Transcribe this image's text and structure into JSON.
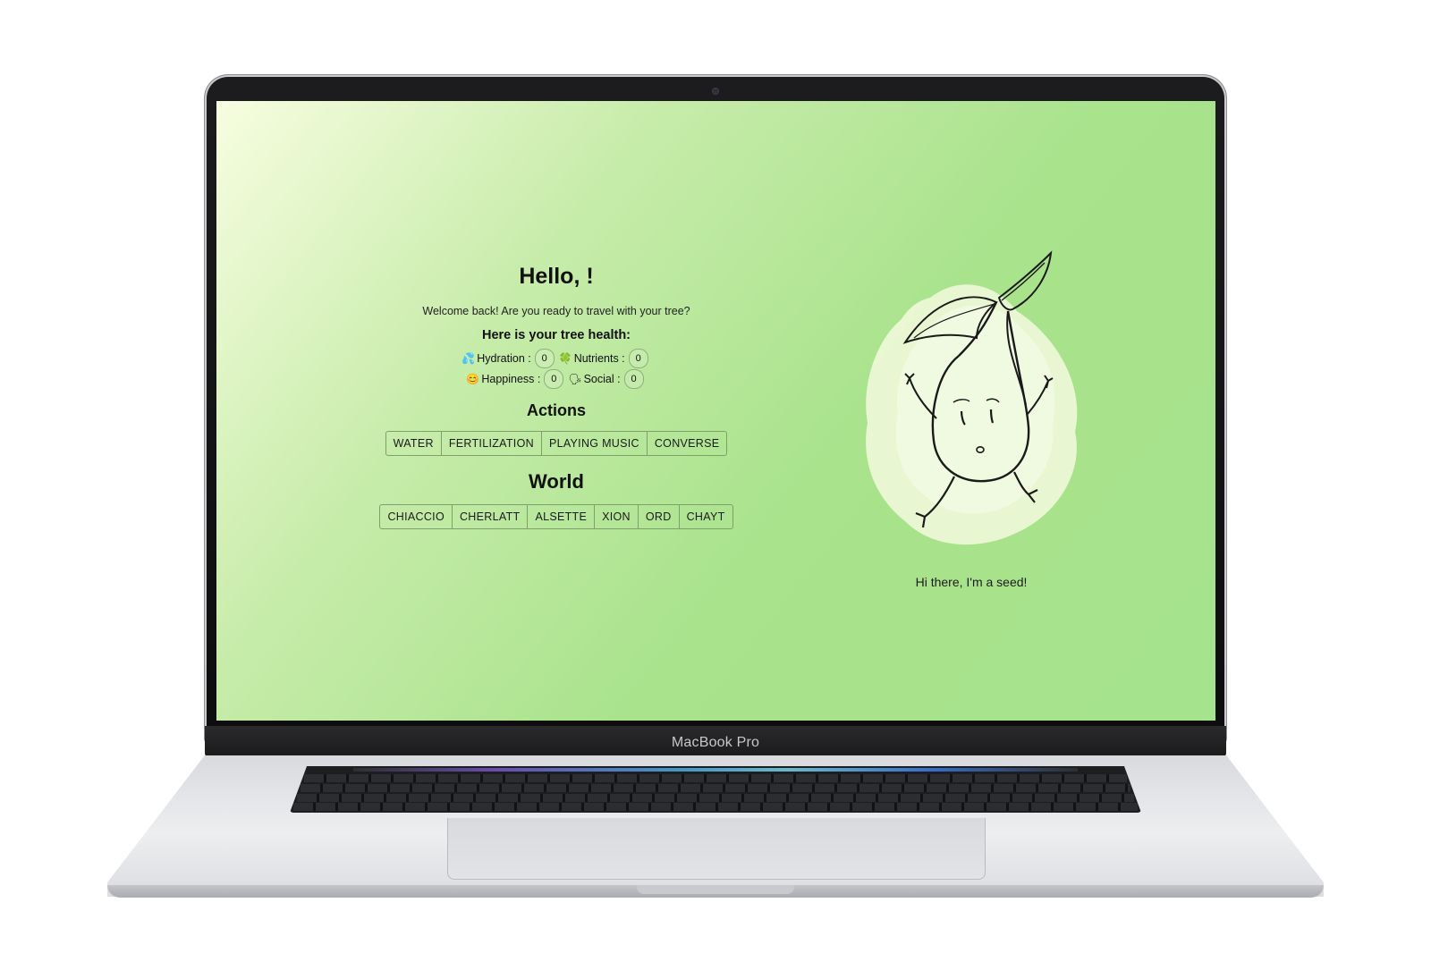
{
  "device": {
    "brand_label": "MacBook Pro"
  },
  "app": {
    "greeting": "Hello, !",
    "welcome": "Welcome back! Are you ready to travel with your tree?",
    "health_title": "Here is your tree health:",
    "stats": {
      "hydration": {
        "icon": "💦",
        "label": "Hydration :",
        "value": "0"
      },
      "nutrients": {
        "icon": "🍀",
        "label": "Nutrients :",
        "value": "0"
      },
      "happiness": {
        "icon": "😊",
        "label": "Happiness :",
        "value": "0"
      },
      "social": {
        "icon": "🗣",
        "label": "Social :",
        "value": "0"
      }
    },
    "actions_title": "Actions",
    "actions": [
      "WATER",
      "FERTILIZATION",
      "PLAYING MUSIC",
      "CONVERSE"
    ],
    "world_title": "World",
    "worlds": [
      "CHIACCIO",
      "CHERLATT",
      "ALSETTE",
      "XION",
      "ORD",
      "CHAYT"
    ],
    "seed_caption": "Hi there, I'm a seed!"
  },
  "colors": {
    "background_light": "#f7fde0",
    "background_green": "#a6e38d",
    "button_border": "#7fa06a"
  }
}
